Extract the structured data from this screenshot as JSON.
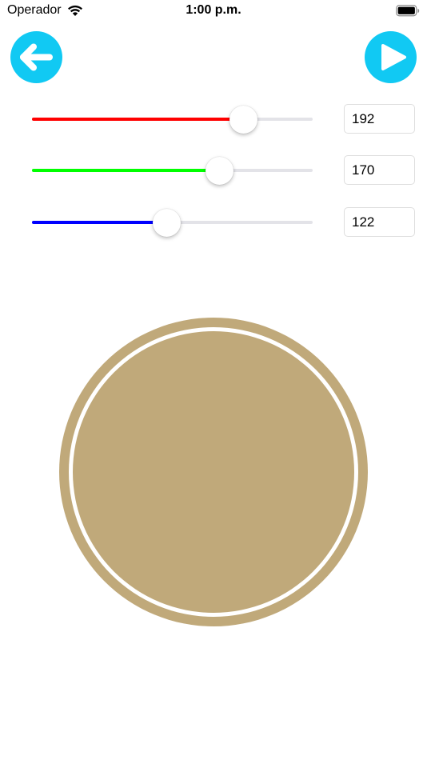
{
  "status_bar": {
    "carrier": "Operador",
    "time": "1:00 p.m.",
    "icons": [
      "wifi-icon",
      "battery-icon"
    ]
  },
  "nav": {
    "back_icon": "arrow-left-icon",
    "play_icon": "play-icon",
    "button_color": "#11c9f3"
  },
  "rgb": {
    "red": {
      "value": "192",
      "level": 0.753,
      "color": "#ff0000"
    },
    "green": {
      "value": "170",
      "level": 0.667,
      "color": "#00ff00"
    },
    "blue": {
      "value": "122",
      "level": 0.478,
      "color": "#0000ff"
    }
  },
  "preview": {
    "color": "#c0a97a"
  }
}
